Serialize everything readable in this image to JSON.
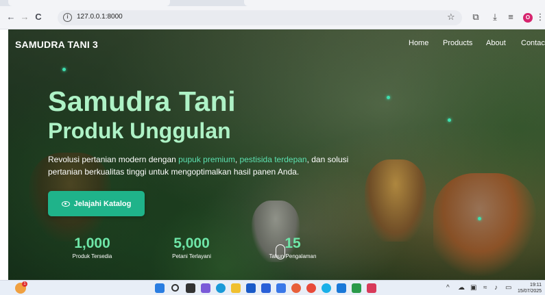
{
  "browser": {
    "url": "127.0.0.1:8000",
    "back": "←",
    "forward": "→",
    "reload": "C",
    "profile_initial": "O"
  },
  "site": {
    "brand": "SAMUDRA TANI 3",
    "nav": [
      "Home",
      "Products",
      "About",
      "Contac"
    ],
    "title_line1": "Samudra Tani",
    "title_line2": "Produk Unggulan",
    "desc_part1": "Revolusi pertanian modern dengan ",
    "desc_hl1": "pupuk premium",
    "desc_part2": ", ",
    "desc_hl2": "pestisida terdepan",
    "desc_part3": ", dan solusi pertanian berkualitas tinggi untuk mengoptimalkan hasil panen Anda.",
    "cta": "Jelajahi Katalog",
    "stats": [
      {
        "value": "1,000",
        "label": "Produk Tersedia"
      },
      {
        "value": "5,000",
        "label": "Petani Terlayani"
      },
      {
        "value": "15",
        "label": "Tahun Pengalaman"
      }
    ]
  },
  "taskbar": {
    "notification_count": "1",
    "time": "19:11",
    "date": "15/07/2025"
  },
  "colors": {
    "accent": "#1fb38a",
    "title": "#aef2c6",
    "highlight": "#5ce0b0"
  }
}
